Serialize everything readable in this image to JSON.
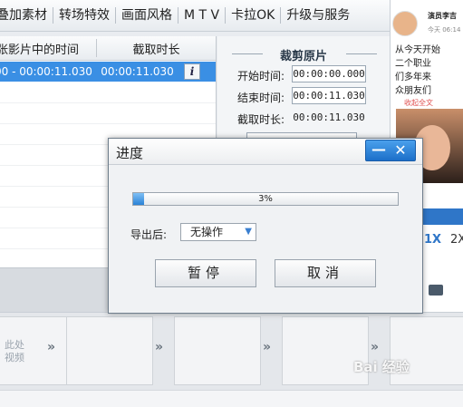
{
  "menu": [
    "叠加素材",
    "转场特效",
    "画面风格",
    "M T V",
    "卡拉OK",
    "升级与服务"
  ],
  "clip_list": {
    "headers": [
      "张影片中的时间",
      "截取时长"
    ],
    "rows": [
      {
        "time_range": "00 - 00:00:11.030",
        "duration": "00:00:11.030",
        "info_icon": "i"
      }
    ]
  },
  "crop_panel": {
    "title": "裁剪原片",
    "start_label": "开始时间:",
    "start_value": "00:00:00.000",
    "end_label": "结束时间:",
    "end_value": "00:00:11.030",
    "duration_label": "截取时长:",
    "duration_value": "00:00:11.030"
  },
  "weibo": {
    "name": "演员李吉",
    "time": "今天 06:14",
    "lines": [
      "从今天开始",
      "二个职业",
      "们多年来",
      "众朋友们"
    ],
    "link": "收起全文"
  },
  "speed": {
    "current": "1X",
    "next": "2X"
  },
  "filmstrip": {
    "placeholder": "此处\n视频"
  },
  "watermark": "Bai 经验",
  "progress_dialog": {
    "title": "进度",
    "minimize_icon": "—",
    "close_icon": "✕",
    "progress_percent": 3,
    "progress_text": "3%",
    "after_label": "导出后:",
    "after_value": "无操作",
    "pause_button": "暂停",
    "cancel_button": "取消"
  },
  "colors": {
    "accent": "#2f7fd6",
    "selection": "#3a8fe4"
  }
}
